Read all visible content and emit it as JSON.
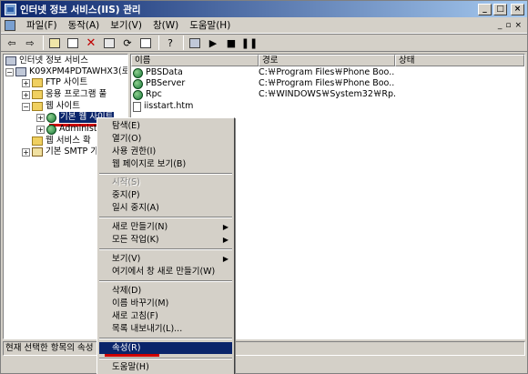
{
  "window": {
    "title": "인터넷 정보 서비스(IIS) 관리"
  },
  "menubar": {
    "items": [
      "파일(F)",
      "동작(A)",
      "보기(V)",
      "창(W)",
      "도움말(H)"
    ],
    "mdi_min": "_",
    "mdi_restore": "▫",
    "mdi_close": "×"
  },
  "tree": {
    "root": "인터넷 정보 서비스",
    "computer": "K09XPM4PDTAWHX3(로",
    "ftp": "FTP 사이트",
    "app_pools": "응용 프로그램 풀",
    "web_sites": "웹 사이트",
    "default_site": "기본 웹 사이트",
    "admin_site": "Administ",
    "web_ext": "웹 서비스 확",
    "smtp": "기본 SMTP 가"
  },
  "list": {
    "columns": [
      "이름",
      "경로",
      "상태"
    ],
    "rows": [
      {
        "name": "PBSData",
        "path": "C:￦Program Files￦Phone Boo..."
      },
      {
        "name": "PBServer",
        "path": "C:￦Program Files￦Phone Boo..."
      },
      {
        "name": "Rpc",
        "path": "C:￦WINDOWS￦System32￦Rp..."
      },
      {
        "name": "iisstart.htm",
        "path": ""
      }
    ]
  },
  "statusbar": {
    "text": "현재 선택한 항목의 속성"
  },
  "context_menu": {
    "items": [
      {
        "label": "탐색(E)",
        "disabled": false
      },
      {
        "label": "열기(O)",
        "disabled": false
      },
      {
        "label": "사용 권한(I)",
        "disabled": false
      },
      {
        "label": "웹 페이지로 보기(B)",
        "disabled": false
      },
      {
        "label": "시작(S)",
        "disabled": true
      },
      {
        "label": "중지(P)",
        "disabled": false
      },
      {
        "label": "일시 중지(A)",
        "disabled": false
      },
      {
        "label": "새로 만들기(N)",
        "disabled": false,
        "submenu": true
      },
      {
        "label": "모든 작업(K)",
        "disabled": false,
        "submenu": true
      },
      {
        "label": "보기(V)",
        "disabled": false,
        "submenu": true
      },
      {
        "label": "여기에서 창 새로 만들기(W)",
        "disabled": false
      },
      {
        "label": "삭제(D)",
        "disabled": false
      },
      {
        "label": "이름 바꾸기(M)",
        "disabled": false
      },
      {
        "label": "새로 고침(F)",
        "disabled": false
      },
      {
        "label": "목록 내보내기(L)...",
        "disabled": false
      },
      {
        "label": "속성(R)",
        "disabled": false,
        "highlighted": true
      },
      {
        "label": "도움말(H)",
        "disabled": false
      }
    ]
  },
  "colors": {
    "title_active": "#0a246a",
    "selection": "#0a246a",
    "annotation_red": "#d00000"
  }
}
